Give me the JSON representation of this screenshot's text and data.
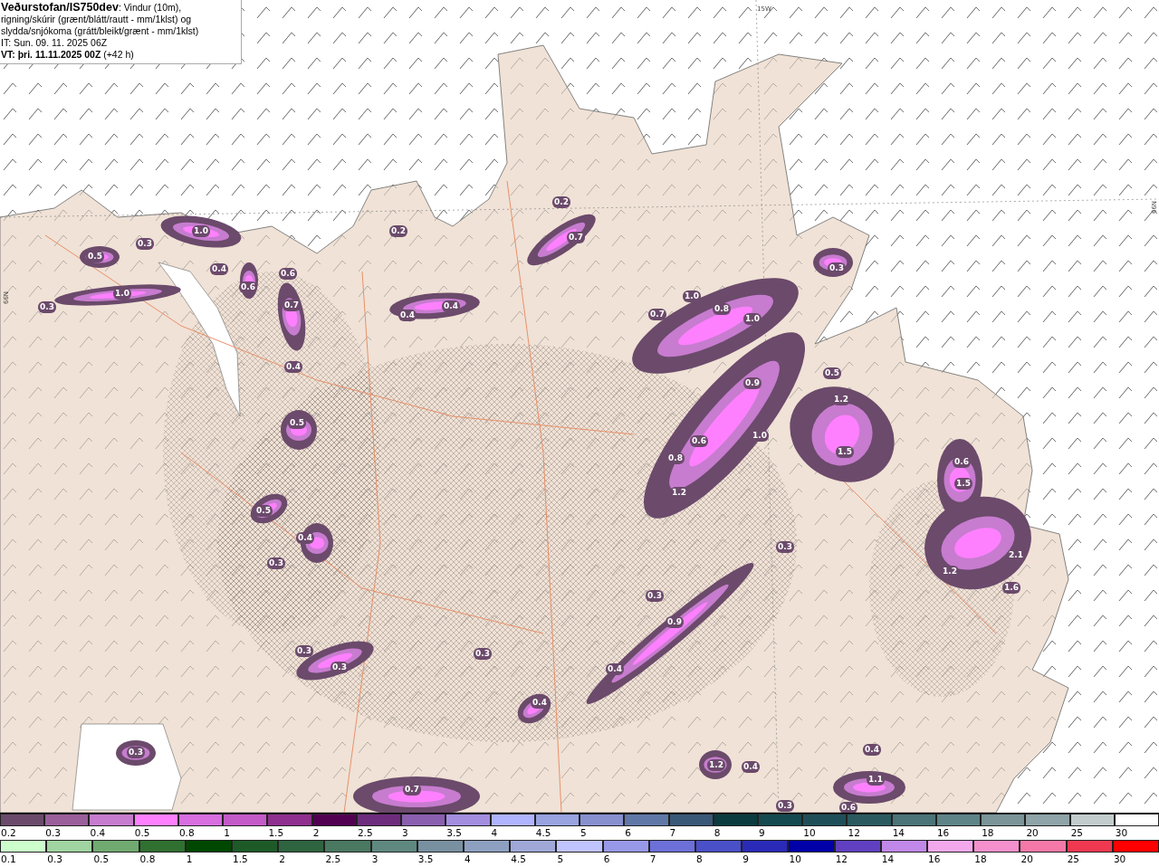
{
  "header": {
    "description": "**Veðurstofan/IS750dev**: Vindur (10m), rigning/skúrir (grænt/blátt/rautt - mm/1klst) og slydda/snjókoma (grátt/bleikt/grænt - mm/1klst)",
    "issue_time": "IT: Sun. 09. 11. 2025 06Z",
    "valid_time": "**VT: þri. 11.11.2025 00Z** (+42 h)"
  },
  "grid_labels": [
    "15W",
    "66N",
    "66N"
  ],
  "map_labels": [
    "0.3",
    "1.0",
    "0.5",
    "0.4",
    "0.6",
    "0.6",
    "1.0",
    "0.3",
    "0.7",
    "0.4",
    "0.5",
    "0.5",
    "0.4",
    "0.3",
    "0.3",
    "0.3",
    "0.3",
    "0.7",
    "0.2",
    "0.7",
    "0.2",
    "0.4",
    "0.4",
    "1.0",
    "0.7",
    "0.8",
    "1.0",
    "0.3",
    "0.9",
    "0.5",
    "1.2",
    "0.6",
    "0.8",
    "1.0",
    "1.5",
    "1.2",
    "0.3",
    "0.6",
    "1.5",
    "2.1",
    "1.2",
    "1.6",
    "0.3",
    "0.9",
    "0.3",
    "0.4",
    "0.4",
    "1.2",
    "0.4",
    "0.4",
    "1.1",
    "0.3",
    "0.6"
  ],
  "legends": [
    {
      "items": [
        {
          "label": "0.2",
          "color": "#6b4a6b"
        },
        {
          "label": "0.3",
          "color": "#9b5f9b"
        },
        {
          "label": "0.4",
          "color": "#c77ccf"
        },
        {
          "label": "0.5",
          "color": "#ff80ff"
        },
        {
          "label": "0.8",
          "color": "#d86ee0"
        },
        {
          "label": "1",
          "color": "#c45ac8"
        },
        {
          "label": "1.5",
          "color": "#8f2f8f"
        },
        {
          "label": "2",
          "color": "#520052"
        },
        {
          "label": "2.5",
          "color": "#6e2c7e"
        },
        {
          "label": "3",
          "color": "#8a5fb0"
        },
        {
          "label": "3.5",
          "color": "#a38ee0"
        },
        {
          "label": "4",
          "color": "#b0b4ff"
        },
        {
          "label": "4.5",
          "color": "#98a3e0"
        },
        {
          "label": "5",
          "color": "#8890d0"
        },
        {
          "label": "6",
          "color": "#6078a8"
        },
        {
          "label": "7",
          "color": "#3a5878"
        },
        {
          "label": "8",
          "color": "#0a3c40"
        },
        {
          "label": "9",
          "color": "#154a50"
        },
        {
          "label": "10",
          "color": "#1e4f58"
        },
        {
          "label": "12",
          "color": "#2a5a60"
        },
        {
          "label": "14",
          "color": "#4a7478"
        },
        {
          "label": "16",
          "color": "#5f8488"
        },
        {
          "label": "18",
          "color": "#7a9498"
        },
        {
          "label": "20",
          "color": "#8ea4a8"
        },
        {
          "label": "25",
          "color": "#c2cccc"
        },
        {
          "label": "30",
          "color": "#ffffff"
        }
      ]
    },
    {
      "items": [
        {
          "label": "0.1",
          "color": "#ccffcc"
        },
        {
          "label": "0.3",
          "color": "#a0d4a0"
        },
        {
          "label": "0.5",
          "color": "#70aa70"
        },
        {
          "label": "0.8",
          "color": "#307030"
        },
        {
          "label": "1",
          "color": "#004800"
        },
        {
          "label": "1.5",
          "color": "#1e5a28"
        },
        {
          "label": "2",
          "color": "#2e6440"
        },
        {
          "label": "2.5",
          "color": "#4a7860"
        },
        {
          "label": "3",
          "color": "#5f8880"
        },
        {
          "label": "3.5",
          "color": "#7890a0"
        },
        {
          "label": "4",
          "color": "#8ea0c0"
        },
        {
          "label": "4.5",
          "color": "#a0a8d8"
        },
        {
          "label": "5",
          "color": "#c0c4ff"
        },
        {
          "label": "6",
          "color": "#9898e8"
        },
        {
          "label": "7",
          "color": "#6c70d8"
        },
        {
          "label": "8",
          "color": "#4a50c8"
        },
        {
          "label": "9",
          "color": "#2a2ab8"
        },
        {
          "label": "10",
          "color": "#0000a8"
        },
        {
          "label": "12",
          "color": "#6040c0"
        },
        {
          "label": "14",
          "color": "#c088e8"
        },
        {
          "label": "16",
          "color": "#f4a8ec"
        },
        {
          "label": "18",
          "color": "#f490cc"
        },
        {
          "label": "20",
          "color": "#f478a8"
        },
        {
          "label": "25",
          "color": "#f03850"
        },
        {
          "label": "30",
          "color": "#ff0000"
        }
      ]
    }
  ]
}
